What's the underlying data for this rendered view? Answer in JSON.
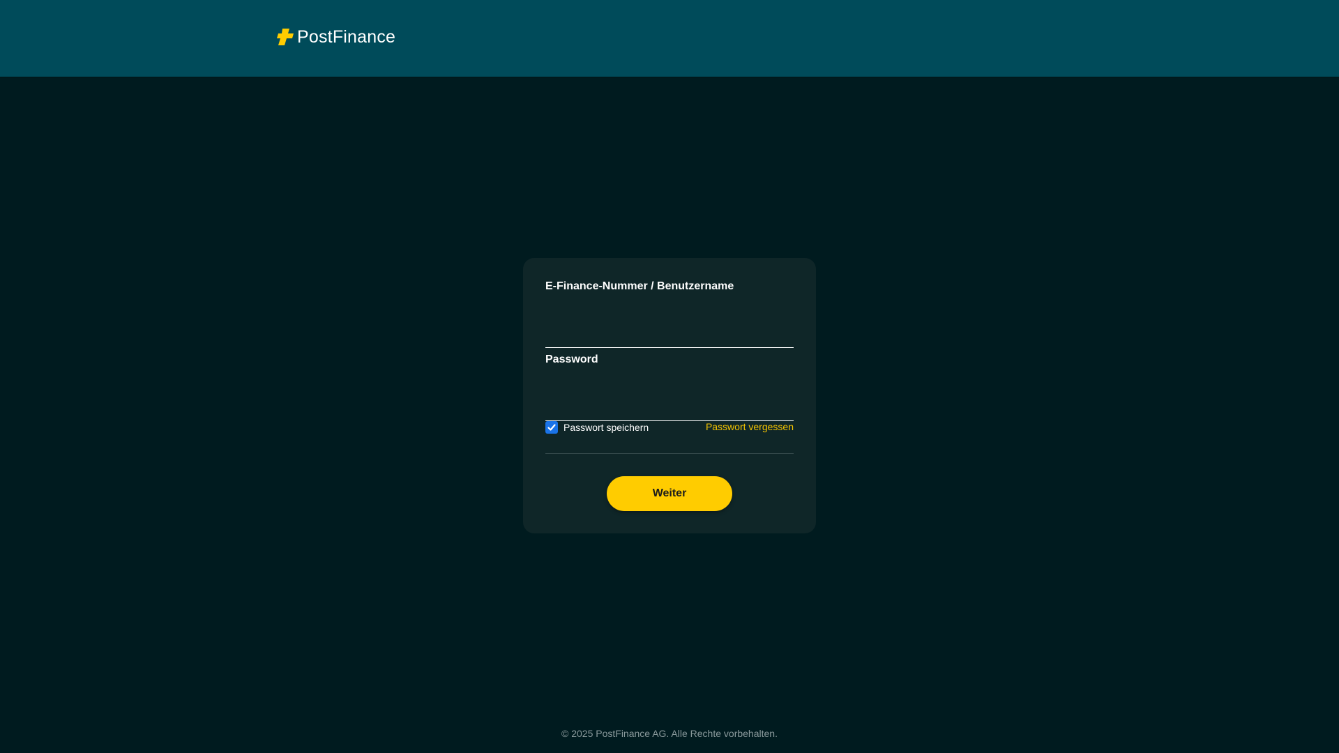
{
  "header": {
    "logo_text": "PostFinance",
    "logo_icon": "postfinance-cross-icon",
    "background_color": "#004b5a",
    "accent_color": "#ffcc00"
  },
  "login_form": {
    "username_label": "E-Finance-Nummer / Benutzername",
    "username_value": "",
    "password_label": "Password",
    "password_value": "",
    "remember_label": "Passwort speichern",
    "remember_checked": true,
    "checkbox_icon": "checkmark-icon",
    "forgot_label": "Passwort vergessen",
    "submit_label": "Weiter"
  },
  "footer": {
    "copyright": "© 2025 PostFinance AG. Alle Rechte vorbehalten."
  }
}
